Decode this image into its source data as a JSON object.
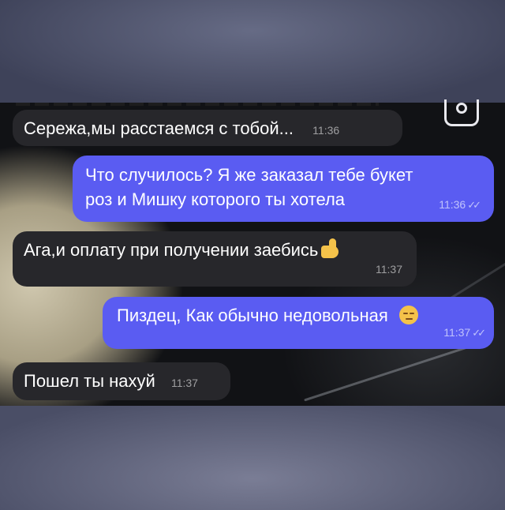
{
  "messages": [
    {
      "direction": "incoming",
      "text": "Сережа,мы расстаемся с тобой...",
      "time": "11:36"
    },
    {
      "direction": "outgoing",
      "line1": "Что случилось? Я же заказал тебе букет",
      "line2": "роз и Мишку которого ты хотела",
      "time": "11:36",
      "status": "read-checkmarks"
    },
    {
      "direction": "incoming",
      "text": "Ага,и оплату при получении заебись",
      "emoji": "thumbs-up-emoji",
      "time": "11:37"
    },
    {
      "direction": "outgoing",
      "text": "Пиздец, Как обычно недовольная",
      "emoji": "unamused-face-emoji",
      "time": "11:37",
      "status": "read-checkmarks"
    },
    {
      "direction": "incoming",
      "text": "Пошел ты нахуй",
      "time": "11:37"
    }
  ],
  "colors": {
    "incoming_bubble": "#27272b",
    "outgoing_bubble": "#5a5cf2",
    "text": "#ffffff"
  },
  "icons": {
    "top_right": "camera-icon",
    "read_status": "double-check-icon"
  }
}
